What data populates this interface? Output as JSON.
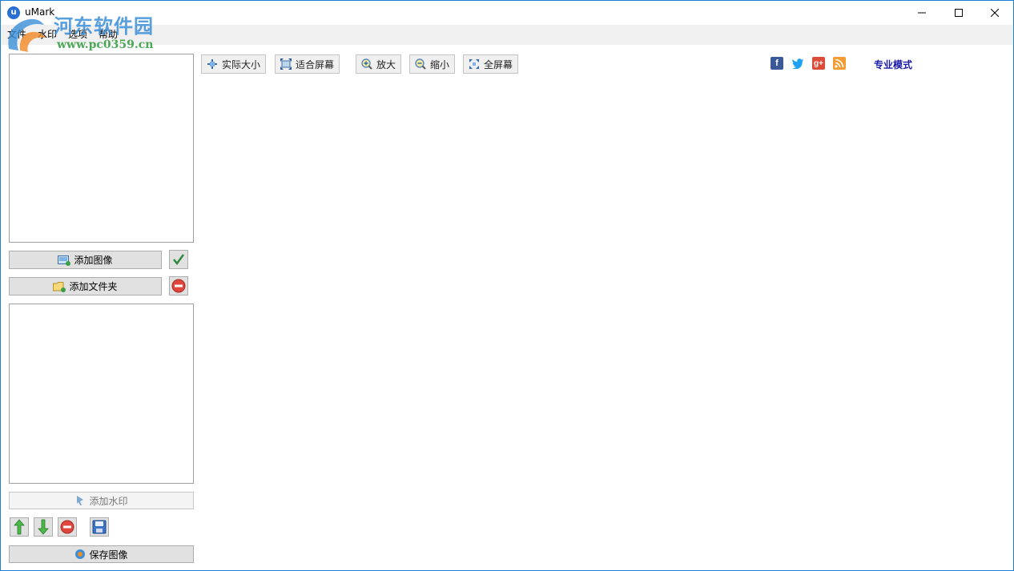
{
  "window": {
    "title": "uMark",
    "minimize_glyph": "—",
    "maximize_glyph": "☐",
    "close_glyph": "✕"
  },
  "watermark": {
    "site_name": "河东软件园",
    "url": "www.pc0359.cn"
  },
  "menu": {
    "items": [
      "文件",
      "水印",
      "选项",
      "帮助"
    ]
  },
  "toolbar": {
    "actual_size": "实际大小",
    "fit_screen": "适合屏幕",
    "zoom_in": "放大",
    "zoom_out": "缩小",
    "fullscreen": "全屏幕"
  },
  "social": {
    "facebook": "f",
    "twitter": "t",
    "googleplus": "g+",
    "rss": "rss"
  },
  "pro_mode": "专业模式",
  "left_panel": {
    "add_image": "添加图像",
    "add_folder": "添加文件夹",
    "add_watermark": "添加水印",
    "save_image": "保存图像"
  },
  "colors": {
    "accent_border": "#1e7fd8",
    "pro_link": "#1a1aa6",
    "menubar_bg": "#f0f0f0"
  },
  "icons": {
    "confirm": "check-icon",
    "remove": "minus-circle-icon",
    "move_up": "arrow-up-icon",
    "move_down": "arrow-down-icon",
    "delete": "minus-circle-icon",
    "save": "floppy-icon"
  }
}
